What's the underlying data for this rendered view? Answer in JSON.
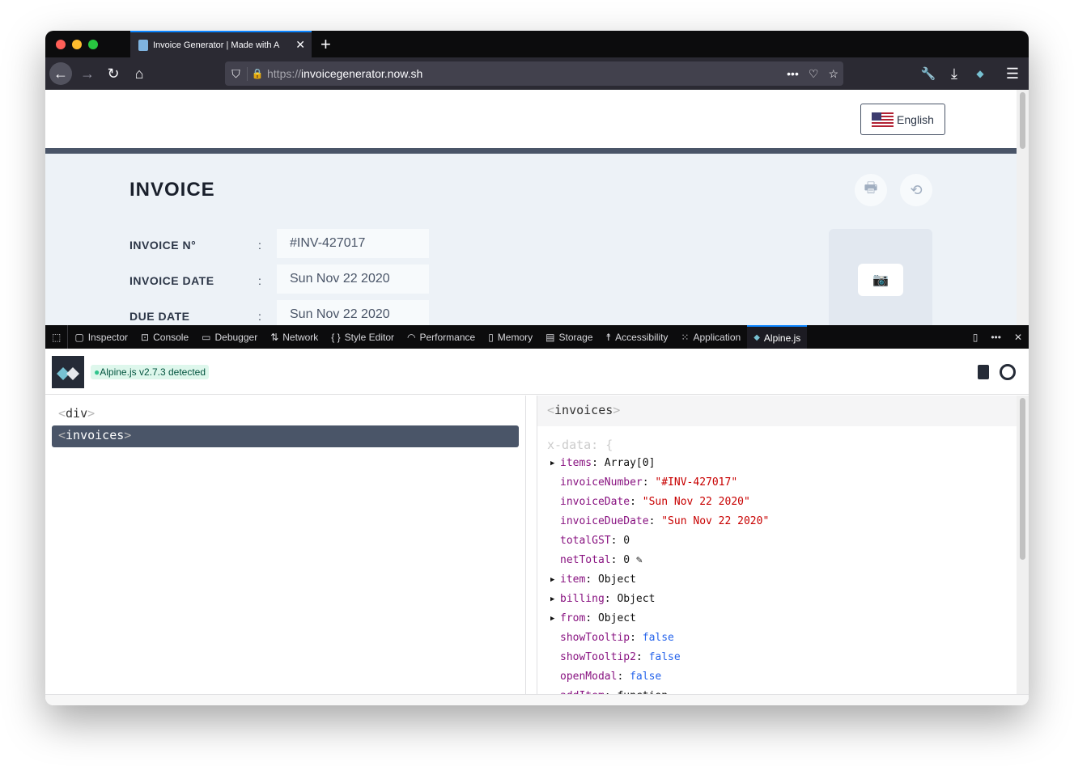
{
  "browser": {
    "tab_title": "Invoice Generator | Made with A",
    "url_scheme": "https://",
    "url_host": "invoicegenerator.now.sh"
  },
  "page": {
    "language": "English",
    "title": "INVOICE",
    "fields": [
      {
        "label": "INVOICE N°",
        "value": "#INV-427017"
      },
      {
        "label": "INVOICE DATE",
        "value": "Sun Nov 22 2020"
      },
      {
        "label": "DUE DATE",
        "value": "Sun Nov 22 2020"
      }
    ],
    "colon": ":"
  },
  "devtools": {
    "tabs": [
      "Inspector",
      "Console",
      "Debugger",
      "Network",
      "Style Editor",
      "Performance",
      "Memory",
      "Storage",
      "Accessibility",
      "Application",
      "Alpine.js"
    ],
    "active_tab": "Alpine.js"
  },
  "alpine": {
    "badge": "Alpine.js v2.7.3 detected",
    "tree": [
      {
        "name": "div"
      },
      {
        "name": "invoices",
        "selected": true
      }
    ],
    "selected": "invoices",
    "xdata_label": "x-data: {",
    "props": [
      {
        "key": "items",
        "value": "Array[0]",
        "type": "obj",
        "expand": true
      },
      {
        "key": "invoiceNumber",
        "value": "\"#INV-427017\"",
        "type": "str"
      },
      {
        "key": "invoiceDate",
        "value": "\"Sun Nov 22 2020\"",
        "type": "str"
      },
      {
        "key": "invoiceDueDate",
        "value": "\"Sun Nov 22 2020\"",
        "type": "str"
      },
      {
        "key": "totalGST",
        "value": "0",
        "type": "num"
      },
      {
        "key": "netTotal",
        "value": "0",
        "type": "num",
        "editing": true
      },
      {
        "key": "item",
        "value": "Object",
        "type": "obj",
        "expand": true
      },
      {
        "key": "billing",
        "value": "Object",
        "type": "obj",
        "expand": true
      },
      {
        "key": "from",
        "value": "Object",
        "type": "obj",
        "expand": true
      },
      {
        "key": "showTooltip",
        "value": "false",
        "type": "bool"
      },
      {
        "key": "showTooltip2",
        "value": "false",
        "type": "bool"
      },
      {
        "key": "openModal",
        "value": "false",
        "type": "bool"
      },
      {
        "key": "addItem",
        "value": "function",
        "type": "num"
      }
    ]
  }
}
